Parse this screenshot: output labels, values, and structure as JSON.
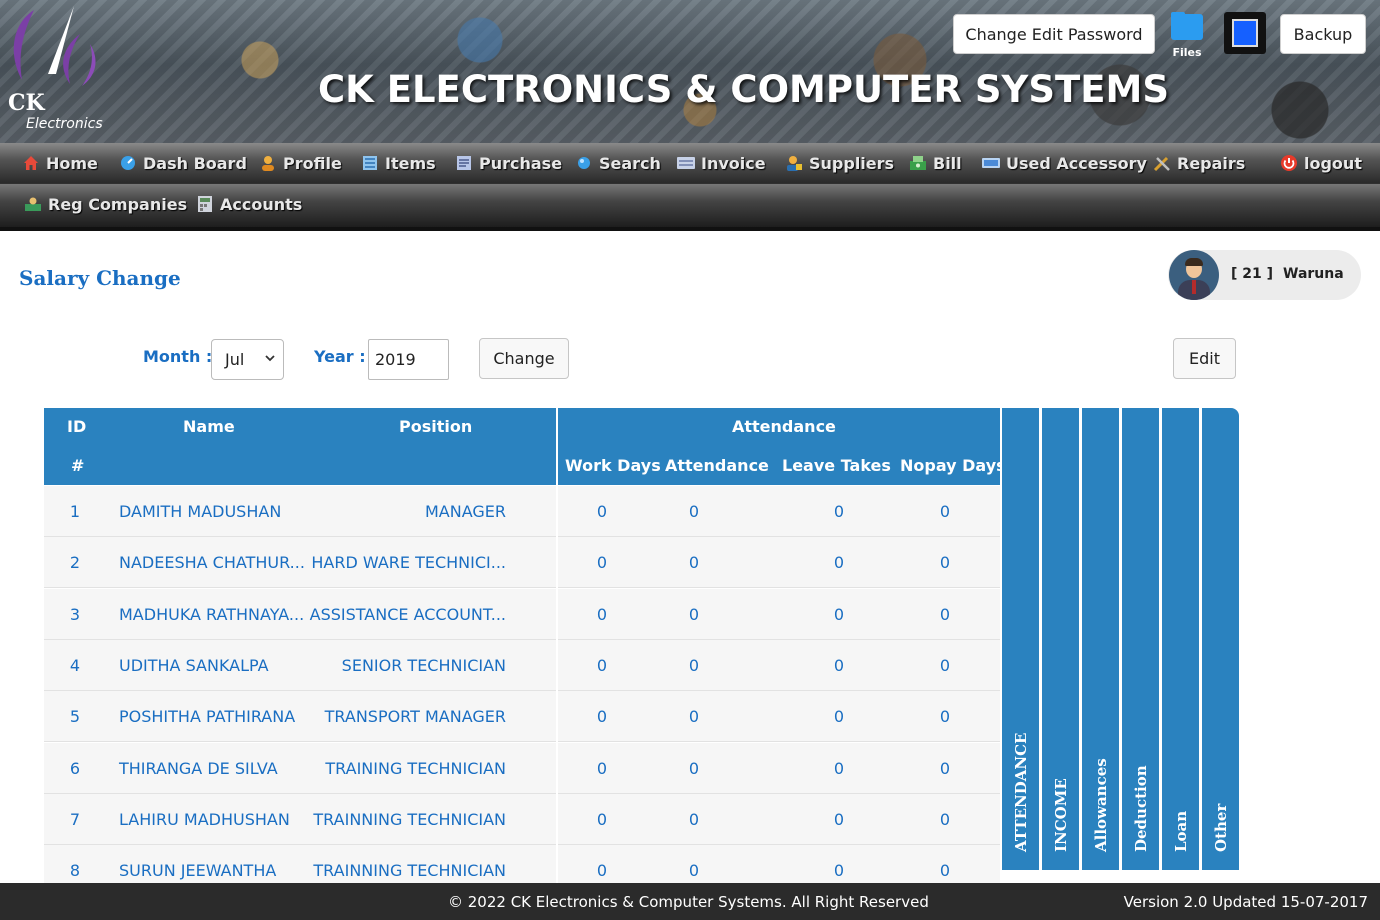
{
  "header": {
    "logo_text_1": "CK",
    "logo_text_2": "Electronics",
    "title": "CK ELECTRONICS & COMPUTER SYSTEMS",
    "change_password_label": "Change Edit Password",
    "files_label": "Files",
    "backup_label": "Backup"
  },
  "nav": {
    "row1": [
      {
        "label": "Home",
        "icon": "home-icon"
      },
      {
        "label": "Dash Board",
        "icon": "dashboard-icon"
      },
      {
        "label": "Profile",
        "icon": "profile-icon"
      },
      {
        "label": "Items",
        "icon": "items-icon"
      },
      {
        "label": "Purchase",
        "icon": "purchase-icon"
      },
      {
        "label": "Search",
        "icon": "search-icon"
      },
      {
        "label": "Invoice",
        "icon": "invoice-icon"
      },
      {
        "label": "Suppliers",
        "icon": "suppliers-icon"
      },
      {
        "label": "Bill",
        "icon": "bill-icon"
      },
      {
        "label": "Used Accessory",
        "icon": "accessory-icon"
      },
      {
        "label": "Repairs",
        "icon": "repairs-icon"
      },
      {
        "label": "logout",
        "icon": "power-icon"
      }
    ],
    "row2": [
      {
        "label": "Reg Companies",
        "icon": "companies-icon"
      },
      {
        "label": "Accounts",
        "icon": "accounts-icon"
      }
    ]
  },
  "page": {
    "title": "Salary Change",
    "user": {
      "id": "[ 21 ]",
      "name": "Waruna"
    }
  },
  "filters": {
    "month_label": "Month :",
    "month_value": "Jul",
    "year_label": "Year :",
    "year_value": "2019",
    "change_label": "Change",
    "edit_label": "Edit"
  },
  "table": {
    "headers": {
      "id": "ID",
      "hash": "#",
      "name": "Name",
      "position": "Position",
      "attendance_group": "Attendance",
      "work_days": "Work Days",
      "attendance": "Attendance",
      "leave_takes": "Leave Takes",
      "nopay_days": "Nopay Days"
    },
    "rows": [
      {
        "id": "1",
        "name": "DAMITH MADUSHAN",
        "position": "MANAGER",
        "work_days": "0",
        "attendance": "0",
        "leave_takes": "0",
        "nopay_days": "0"
      },
      {
        "id": "2",
        "name": "NADEESHA CHATHUR...",
        "position": "HARD WARE TECHNICI...",
        "work_days": "0",
        "attendance": "0",
        "leave_takes": "0",
        "nopay_days": "0"
      },
      {
        "id": "3",
        "name": "MADHUKA RATHNAYA...",
        "position": "ASSISTANCE ACCOUNT...",
        "work_days": "0",
        "attendance": "0",
        "leave_takes": "0",
        "nopay_days": "0"
      },
      {
        "id": "4",
        "name": "UDITHA SANKALPA",
        "position": "SENIOR TECHNICIAN",
        "work_days": "0",
        "attendance": "0",
        "leave_takes": "0",
        "nopay_days": "0"
      },
      {
        "id": "5",
        "name": "POSHITHA PATHIRANA",
        "position": "TRANSPORT MANAGER",
        "work_days": "0",
        "attendance": "0",
        "leave_takes": "0",
        "nopay_days": "0"
      },
      {
        "id": "6",
        "name": "THIRANGA DE SILVA",
        "position": "TRAINING TECHNICIAN",
        "work_days": "0",
        "attendance": "0",
        "leave_takes": "0",
        "nopay_days": "0"
      },
      {
        "id": "7",
        "name": "LAHIRU MADHUSHAN",
        "position": "TRAINNING TECHNICIAN",
        "work_days": "0",
        "attendance": "0",
        "leave_takes": "0",
        "nopay_days": "0"
      },
      {
        "id": "8",
        "name": "SURUN JEEWANTHA",
        "position": "TRAINNING TECHNICIAN",
        "work_days": "0",
        "attendance": "0",
        "leave_takes": "0",
        "nopay_days": "0"
      }
    ],
    "side_tabs": [
      "ATTENDANCE",
      "INCOME",
      "Allowances",
      "Deduction",
      "Loan",
      "Other"
    ]
  },
  "footer": {
    "copyright": "© 2022  CK Electronics & Computer Systems. All Right Reserved",
    "version": "Version 2.0 Updated 15-07-2017"
  }
}
